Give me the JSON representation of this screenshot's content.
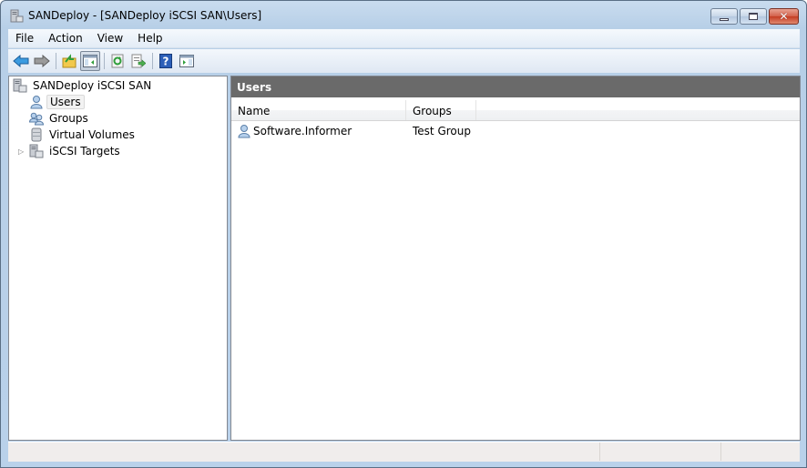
{
  "window": {
    "title": "SANDeploy - [SANDeploy iSCSI SAN\\Users]",
    "icon": "server-icon",
    "controls": {
      "minimize": "minimize",
      "maximize": "maximize",
      "close": "close"
    }
  },
  "menubar": {
    "items": [
      {
        "label": "File"
      },
      {
        "label": "Action"
      },
      {
        "label": "View"
      },
      {
        "label": "Help"
      }
    ]
  },
  "toolbar": {
    "buttons": [
      {
        "icon": "back-arrow-icon"
      },
      {
        "icon": "forward-arrow-icon"
      },
      {
        "icon": "up-folder-icon"
      },
      {
        "icon": "show-hide-console-tree-icon",
        "pressed": true
      },
      {
        "icon": "refresh-icon"
      },
      {
        "icon": "export-list-icon"
      },
      {
        "icon": "help-icon"
      },
      {
        "icon": "show-hide-action-pane-icon"
      }
    ]
  },
  "tree": {
    "root": {
      "label": "SANDeploy iSCSI SAN",
      "icon": "server-icon"
    },
    "items": [
      {
        "label": "Users",
        "icon": "user-icon",
        "selected": true
      },
      {
        "label": "Groups",
        "icon": "group-icon"
      },
      {
        "label": "Virtual Volumes",
        "icon": "database-icon"
      },
      {
        "label": "iSCSI Targets",
        "icon": "server-icon",
        "expandable": true
      }
    ]
  },
  "content": {
    "header": "Users",
    "columns": [
      {
        "label": "Name"
      },
      {
        "label": "Groups"
      }
    ],
    "rows": [
      {
        "name": "Software.Informer",
        "groups": "Test Group",
        "icon": "user-icon"
      }
    ]
  },
  "statusbar": {
    "segments": [
      "",
      "",
      ""
    ]
  }
}
